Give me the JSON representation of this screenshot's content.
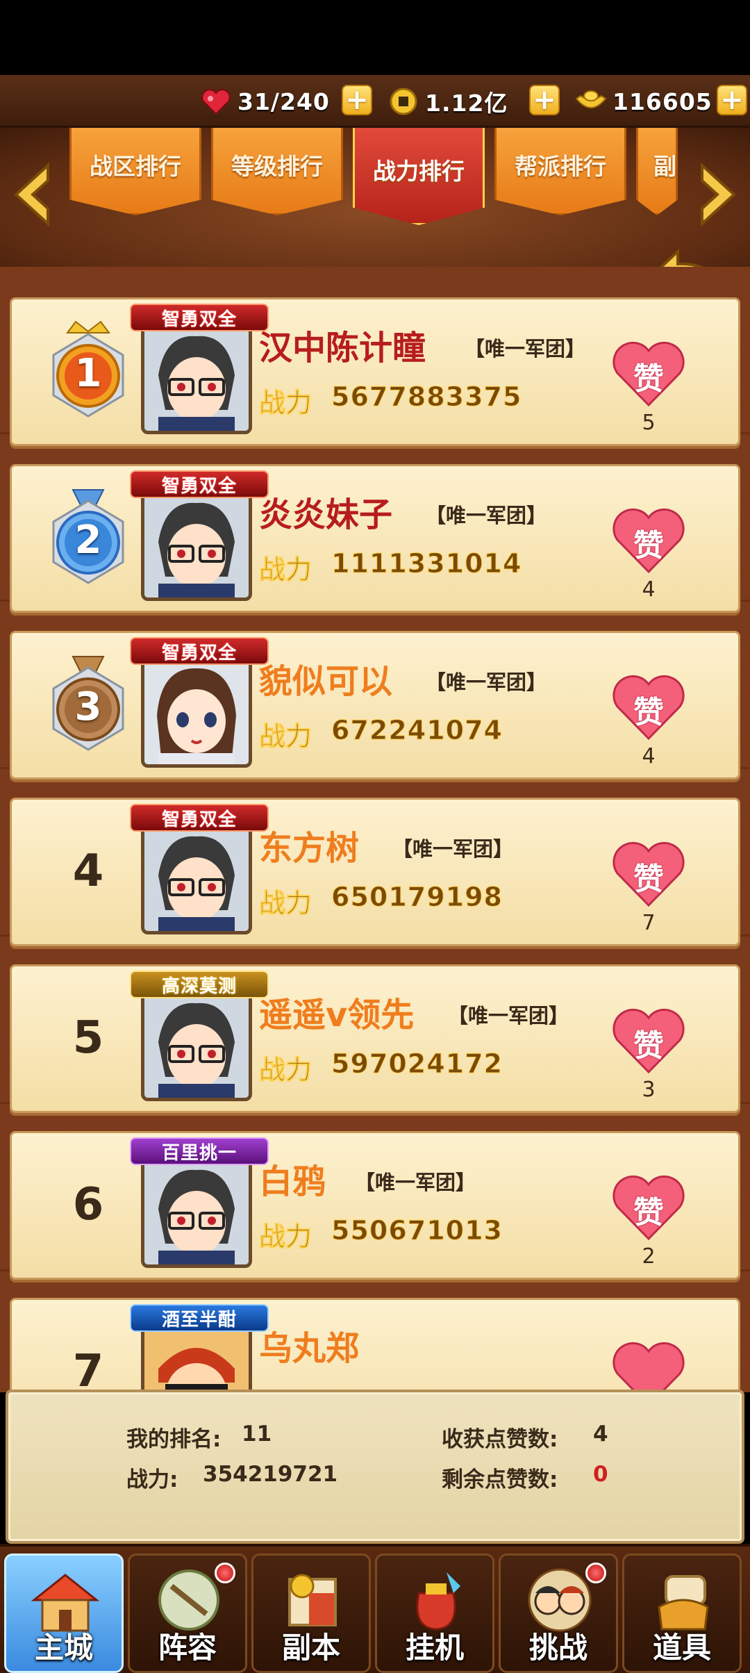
{
  "resources": {
    "stamina": "31/240",
    "coins": "1.12亿",
    "gold": "116605",
    "plus": "+"
  },
  "tabs": [
    {
      "label": "战区排行",
      "active": false
    },
    {
      "label": "等级排行",
      "active": false
    },
    {
      "label": "战力排行",
      "active": true
    },
    {
      "label": "帮派排行",
      "active": false
    },
    {
      "label": "副",
      "active": false
    }
  ],
  "list": {
    "power_label": "战力",
    "like_label": "赞",
    "entries": [
      {
        "rank": "1",
        "title": "智勇双全",
        "name": "汉中陈计瞳",
        "guild": "【唯一军团】",
        "power": "5677883375",
        "likes": "5"
      },
      {
        "rank": "2",
        "title": "智勇双全",
        "name": "炎炎妹子",
        "guild": "【唯一军团】",
        "power": "1111331014",
        "likes": "4"
      },
      {
        "rank": "3",
        "title": "智勇双全",
        "name": "貌似可以",
        "guild": "【唯一军团】",
        "power": "672241074",
        "likes": "4"
      },
      {
        "rank": "4",
        "title": "智勇双全",
        "name": "东方树",
        "guild": "【唯一军团】",
        "power": "650179198",
        "likes": "7"
      },
      {
        "rank": "5",
        "title": "高深莫测",
        "name": "遥遥v领先",
        "guild": "【唯一军团】",
        "power": "597024172",
        "likes": "3"
      },
      {
        "rank": "6",
        "title": "百里挑一",
        "name": "白鸦",
        "guild": "【唯一军团】",
        "power": "550671013",
        "likes": "2"
      },
      {
        "rank": "7",
        "title": "酒至半酣",
        "name": "乌丸郑",
        "guild": "",
        "power": "",
        "likes": ""
      }
    ]
  },
  "my_rank": {
    "rank_label": "我的排名:",
    "rank_value": "11",
    "power_label": "战力:",
    "power_value": "354219721",
    "received_label": "收获点赞数:",
    "received_value": "4",
    "remaining_label": "剩余点赞数:",
    "remaining_value": "0"
  },
  "nav": [
    {
      "label": "主城",
      "active": true,
      "dot": false
    },
    {
      "label": "阵容",
      "active": false,
      "dot": true
    },
    {
      "label": "副本",
      "active": false,
      "dot": false
    },
    {
      "label": "挂机",
      "active": false,
      "dot": false
    },
    {
      "label": "挑战",
      "active": false,
      "dot": true
    },
    {
      "label": "道具",
      "active": false,
      "dot": false
    }
  ]
}
